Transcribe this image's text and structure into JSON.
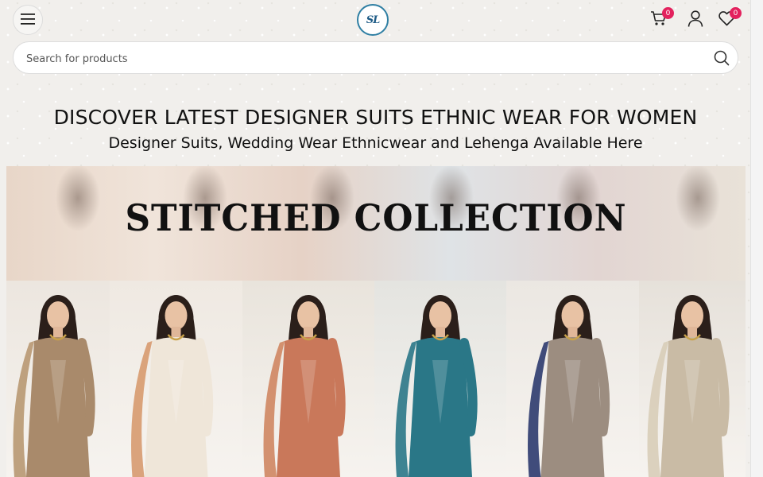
{
  "header": {
    "menu_icon": "hamburger-menu-icon",
    "logo_text": "SL",
    "cart_count": "0",
    "wishlist_count": "0",
    "colors": {
      "badge": "#e3215d",
      "logo": "#2f7fa3"
    }
  },
  "search": {
    "placeholder": "Search for products"
  },
  "main": {
    "heading": "DISCOVER LATEST DESIGNER SUITS ETHNIC WEAR FOR WOMEN",
    "subheading": "Designer Suits, Wedding Wear Ethnicwear and Lehenga Available Here"
  },
  "banner": {
    "title": "STITCHED COLLECTION",
    "models": [
      {
        "outfit_color": "#a98a6b",
        "dupatta_color": "#b89872",
        "bg_color": "#ece6df"
      },
      {
        "outfit_color": "#efe6d9",
        "dupatta_color": "#d79a6f",
        "bg_color": "#efe9e2"
      },
      {
        "outfit_color": "#c9785a",
        "dupatta_color": "#cf8662",
        "bg_color": "#e9e4dc"
      },
      {
        "outfit_color": "#2a7787",
        "dupatta_color": "#2a7787",
        "bg_color": "#e4e4e0"
      },
      {
        "outfit_color": "#9c8d80",
        "dupatta_color": "#2c3a6e",
        "bg_color": "#ebe7e2"
      },
      {
        "outfit_color": "#c9bba5",
        "dupatta_color": "#d8cdb8",
        "bg_color": "#e6e1da"
      }
    ]
  }
}
